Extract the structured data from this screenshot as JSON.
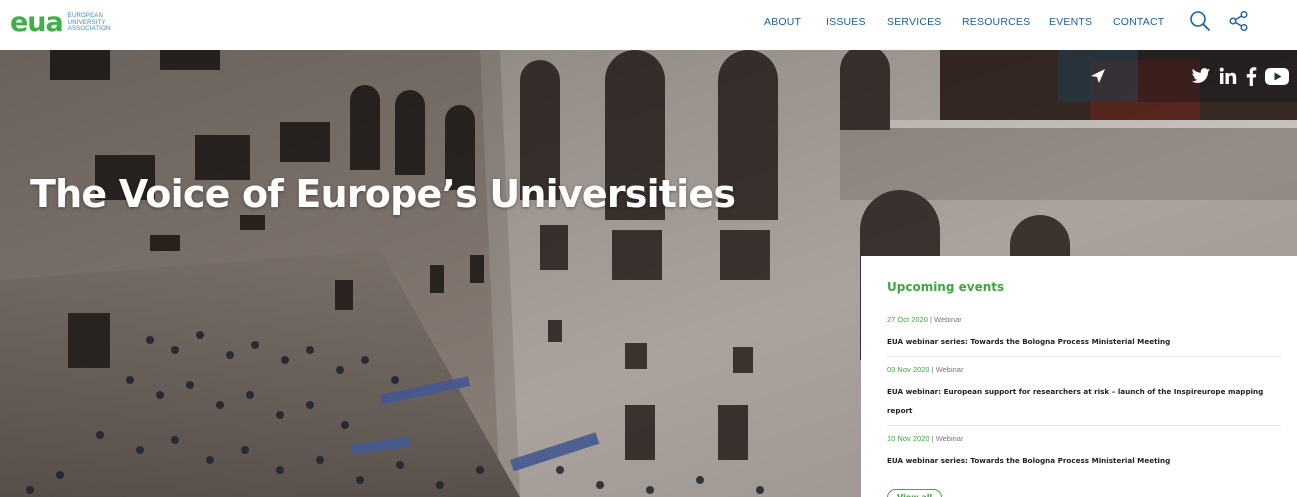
{
  "brand": {
    "logo_mark": "eua",
    "logo_lines": [
      "EUROPEAN",
      "UNIVERSITY",
      "ASSOCIATION"
    ],
    "green": "#3fb049",
    "blue": "#1c5fa0"
  },
  "nav": {
    "items": [
      {
        "label": "ABOUT"
      },
      {
        "label": "ISSUES"
      },
      {
        "label": "SERVICES"
      },
      {
        "label": "RESOURCES"
      },
      {
        "label": "EVENTS"
      },
      {
        "label": "CONTACT"
      }
    ],
    "icons": [
      "search-icon",
      "share-icon"
    ]
  },
  "hero": {
    "title": "The Voice of Europe’s Universities",
    "social": [
      "paper-plane-icon",
      "twitter-icon",
      "linkedin-icon",
      "facebook-icon",
      "youtube-icon"
    ]
  },
  "events": {
    "heading": "Upcoming events",
    "items": [
      {
        "date": "27 Oct 2020",
        "separator": "|",
        "type": "Webinar",
        "title": "EUA webinar series: Towards the Bologna Process Ministerial Meeting"
      },
      {
        "date": "03 Nov 2020",
        "separator": "|",
        "type": "Webinar",
        "title": "EUA webinar: European support for researchers at risk – launch of the Inspireurope mapping report"
      },
      {
        "date": "10 Nov 2020",
        "separator": "|",
        "type": "Webinar",
        "title": "EUA webinar series: Towards the Bologna Process Ministerial Meeting"
      }
    ],
    "view_all_label": "View all"
  }
}
